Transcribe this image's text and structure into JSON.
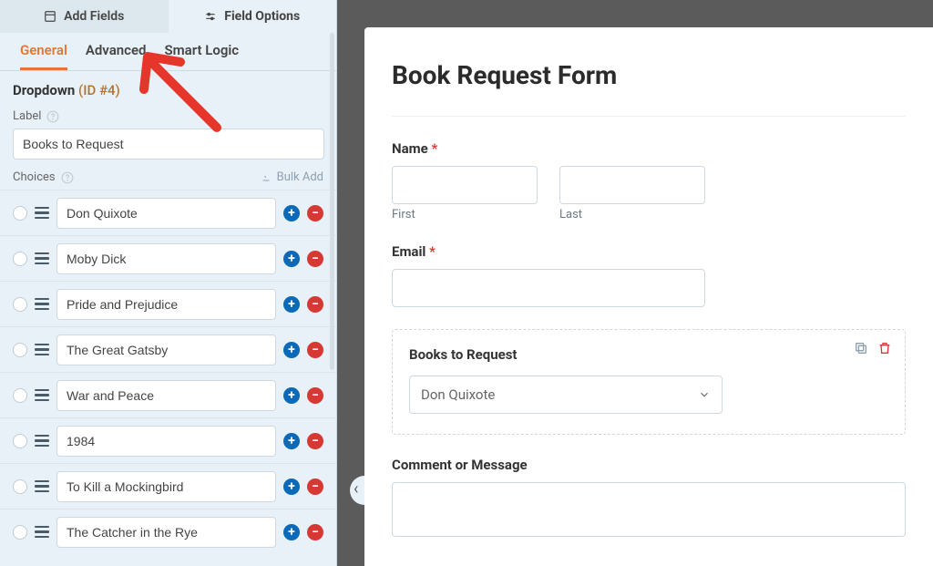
{
  "sidebar": {
    "top_tabs": {
      "add_fields": "Add Fields",
      "field_options": "Field Options"
    },
    "sub_tabs": {
      "general": "General",
      "advanced": "Advanced",
      "smart_logic": "Smart Logic"
    },
    "section_title": "Dropdown",
    "id_label": "(ID #4)",
    "label_field_label": "Label",
    "label_value": "Books to Request",
    "choices_label": "Choices",
    "bulk_add_label": "Bulk Add",
    "choices": [
      "Don Quixote",
      "Moby Dick",
      "Pride and Prejudice",
      "The Great Gatsby",
      "War and Peace",
      "1984",
      "To Kill a Mockingbird",
      "The Catcher in the Rye"
    ]
  },
  "form": {
    "title": "Book Request Form",
    "name_label": "Name",
    "required_mark": "*",
    "first_sub": "First",
    "last_sub": "Last",
    "email_label": "Email",
    "dropdown_label": "Books to Request",
    "dropdown_selected": "Don Quixote",
    "comment_label": "Comment or Message"
  }
}
